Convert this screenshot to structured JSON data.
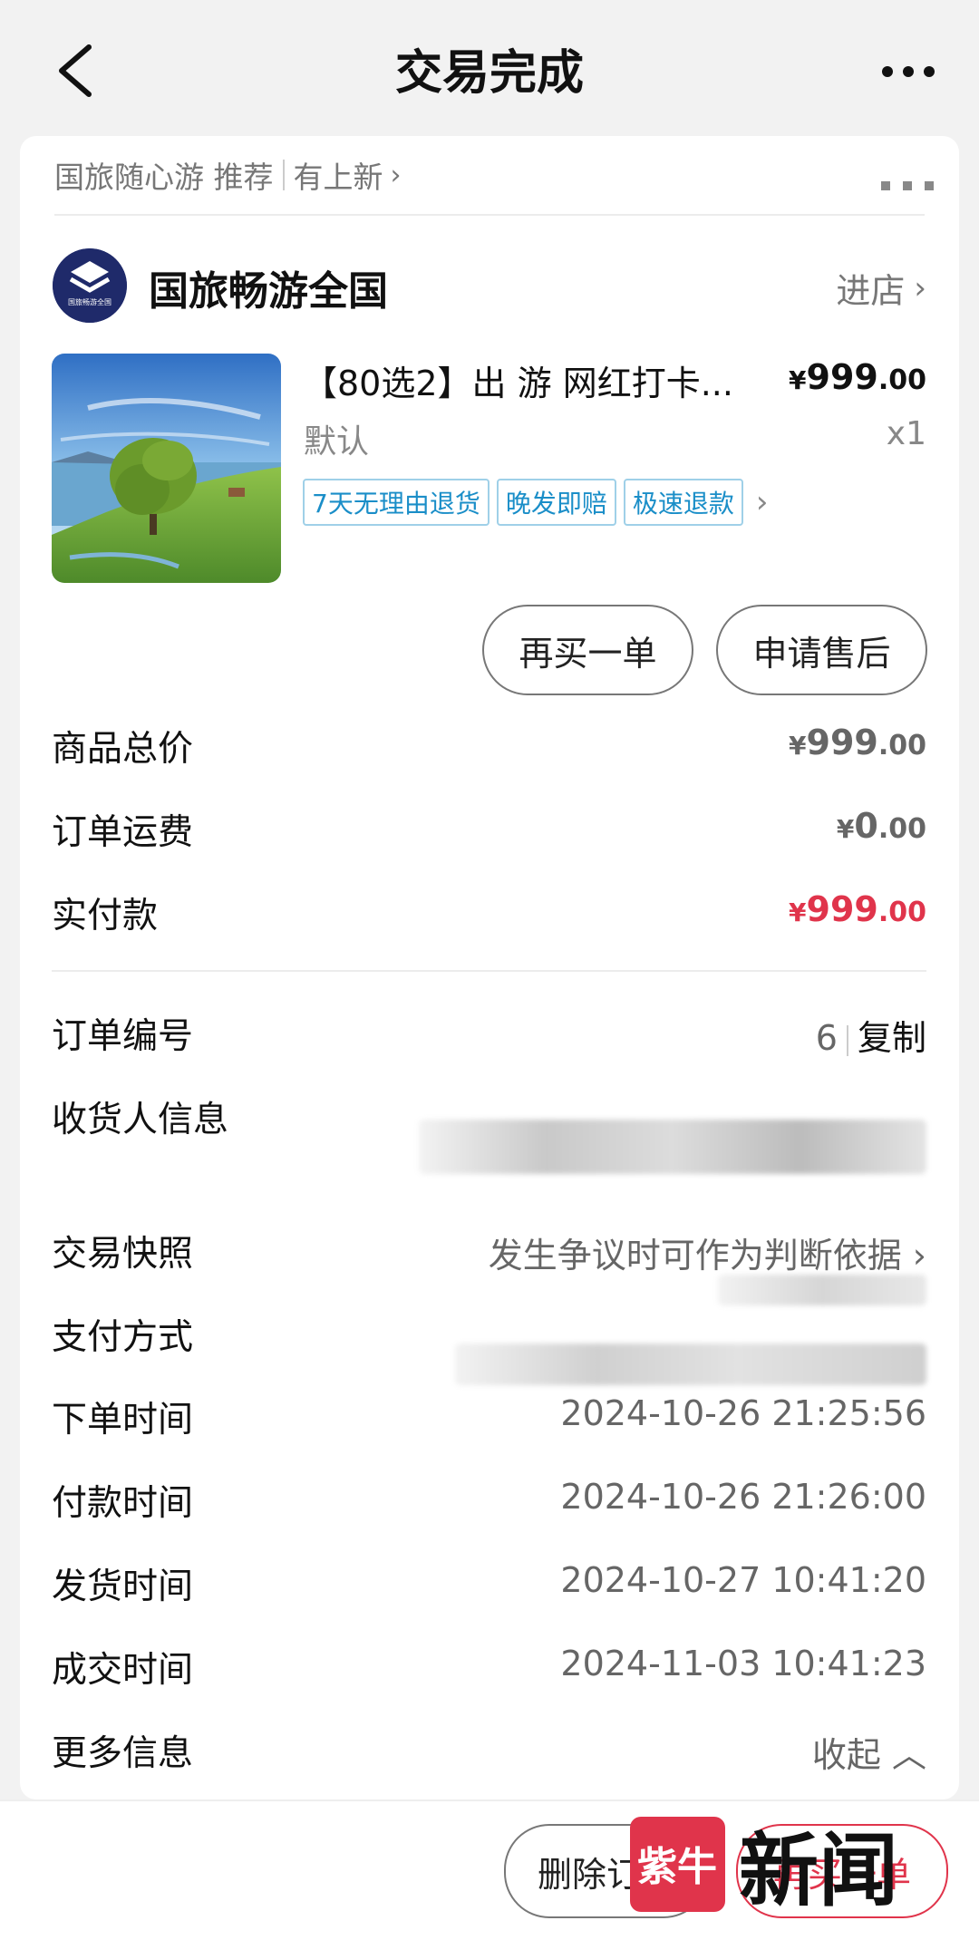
{
  "header": {
    "title": "交易完成"
  },
  "recommend": {
    "text": "国旅随心游 推荐",
    "link": "有上新"
  },
  "shop": {
    "name": "国旅畅游全国",
    "enter_label": "进店",
    "logo_text": "国旅畅游全国"
  },
  "product": {
    "title": "【80选2】出 游 网红打卡...",
    "price_int": "999",
    "price_dec": ".00",
    "currency": "¥",
    "sku": "默认",
    "qty": "x1",
    "tags": [
      "7天无理由退货",
      "晚发即赔",
      "极速退款"
    ]
  },
  "actions": {
    "rebuy": "再买一单",
    "aftersale": "申请售后"
  },
  "summary": {
    "goods_total_label": "商品总价",
    "goods_total_int": "999",
    "goods_total_dec": ".00",
    "shipping_label": "订单运费",
    "shipping_int": "0",
    "shipping_dec": ".00",
    "paid_label": "实付款",
    "paid_int": "999",
    "paid_dec": ".00"
  },
  "order_info": {
    "order_no_label": "订单编号",
    "order_no_value": "6",
    "copy_label": "复制",
    "receiver_label": "收货人信息",
    "snapshot_label": "交易快照",
    "snapshot_value": "发生争议时可作为判断依据",
    "payment_label": "支付方式",
    "created_label": "下单时间",
    "created_value": "2024-10-26 21:25:56",
    "paid_time_label": "付款时间",
    "paid_time_value": "2024-10-26 21:26:00",
    "shipped_label": "发货时间",
    "shipped_value": "2024-10-27 10:41:20",
    "completed_label": "成交时间",
    "completed_value": "2024-11-03 10:41:23",
    "more_label": "更多信息",
    "collapse_label": "收起"
  },
  "bottom_bar": {
    "delete_label": "删除订单",
    "rebuy_label": "再买一单"
  },
  "watermark": {
    "badge": "紫牛",
    "text": "新闻"
  },
  "colors": {
    "accent_red": "#e0344b",
    "tag_blue": "#1a8ec8",
    "logo_navy": "#1f2a6a"
  }
}
